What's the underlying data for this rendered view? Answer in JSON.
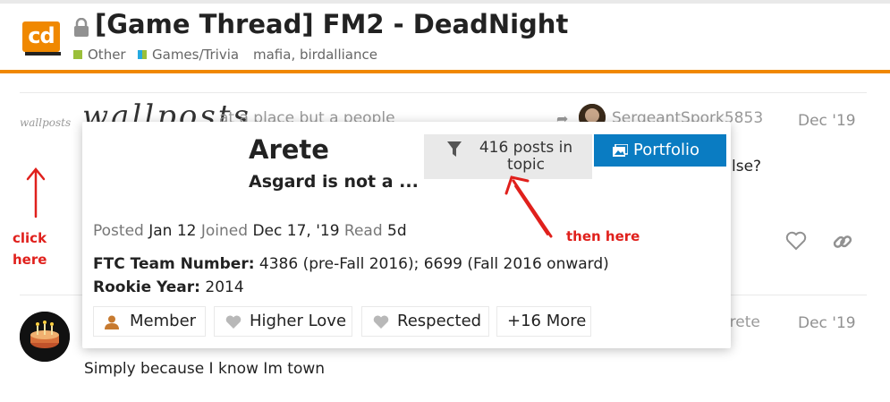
{
  "header": {
    "logo_text": "cd",
    "title": "[Game Thread] FM2 - DeadNight",
    "categories": [
      {
        "label": "Other",
        "color": "#9bbf3a"
      },
      {
        "label": "Games/Trivia",
        "color_left": "#25aae1",
        "color_right": "#9bbf3a"
      }
    ],
    "tags": "mafia, birdalliance",
    "accent_color": "#f08800"
  },
  "post1": {
    "handwritten_small": "wallposts",
    "handwritten_big": "wallposts",
    "text": "at a place but a people",
    "username": "SergeantSpork5853",
    "date": "Dec '19",
    "text_tail": "lse?"
  },
  "post2": {
    "username": "Arete",
    "date": "Dec '19",
    "text": "Simply because I know Im town"
  },
  "user_card": {
    "name": "Arete",
    "title": "Asgard is not a ...",
    "filter_button": "416 posts in topic",
    "portfolio_button": "Portfolio",
    "posted_label": "Posted",
    "posted_value": "Jan 12",
    "joined_label": "Joined",
    "joined_value": "Dec 17, '19",
    "read_label": "Read",
    "read_value": "5d",
    "fields": [
      {
        "label": "FTC Team Number:",
        "value": "4386 (pre-Fall 2016); 6699 (Fall 2016 onward)"
      },
      {
        "label": "Rookie Year:",
        "value": "2014"
      }
    ],
    "badges": [
      {
        "label": "Member",
        "icon": "user-icon"
      },
      {
        "label": "Higher Love",
        "icon": "heart-icon"
      },
      {
        "label": "Respected",
        "icon": "heart-icon"
      },
      {
        "label": "+16 More",
        "icon": ""
      }
    ]
  },
  "annotations": {
    "click_here": "click here",
    "then_here": "then here",
    "color": "#e0201c"
  }
}
